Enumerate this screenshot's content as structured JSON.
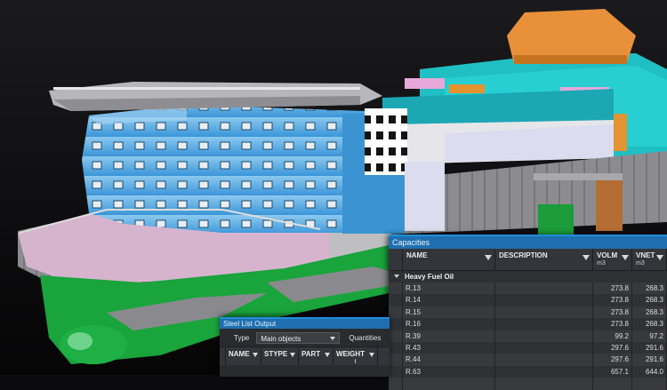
{
  "capacities": {
    "title": "Capacities",
    "columns": [
      {
        "label": "NAME",
        "unit": ""
      },
      {
        "label": "DESCRIPTION",
        "unit": ""
      },
      {
        "label": "VOLM",
        "unit": "m3"
      },
      {
        "label": "VNET",
        "unit": "m3"
      }
    ],
    "group": "Heavy Fuel Oil",
    "rows": [
      {
        "name": "R.13",
        "description": "",
        "volm": "273.8",
        "vnet": "268.3"
      },
      {
        "name": "R.14",
        "description": "",
        "volm": "273.8",
        "vnet": "268.3"
      },
      {
        "name": "R.15",
        "description": "",
        "volm": "273.8",
        "vnet": "268.3"
      },
      {
        "name": "R.16",
        "description": "",
        "volm": "273.8",
        "vnet": "268.3"
      },
      {
        "name": "R.39",
        "description": "",
        "volm": "99.2",
        "vnet": "97.2"
      },
      {
        "name": "R.43",
        "description": "",
        "volm": "297.6",
        "vnet": "291.6"
      },
      {
        "name": "R.44",
        "description": "",
        "volm": "297.6",
        "vnet": "291.6"
      },
      {
        "name": "R.63",
        "description": "",
        "volm": "657.1",
        "vnet": "644.0"
      },
      {
        "name": "",
        "description": "",
        "volm": "",
        "vnet": ""
      }
    ]
  },
  "steel_list": {
    "title": "Steel List Output",
    "type_label": "Type",
    "type_value": "Main objects",
    "quantities_label": "Quantities",
    "columns": [
      {
        "label": "NAME",
        "unit": ""
      },
      {
        "label": "STYPE",
        "unit": ""
      },
      {
        "label": "PART",
        "unit": ""
      },
      {
        "label": "WEIGHT",
        "unit": "t"
      }
    ]
  },
  "colors": {
    "accent": "#1f8fd8",
    "hull_gray": "#8a8a8e",
    "hull_pink": "#d7b6cf",
    "hull_green": "#1fa53f",
    "glass_blue": "#4aa6e0",
    "superstructure_teal": "#1fc2c6",
    "funnel_orange": "#e8903a"
  }
}
